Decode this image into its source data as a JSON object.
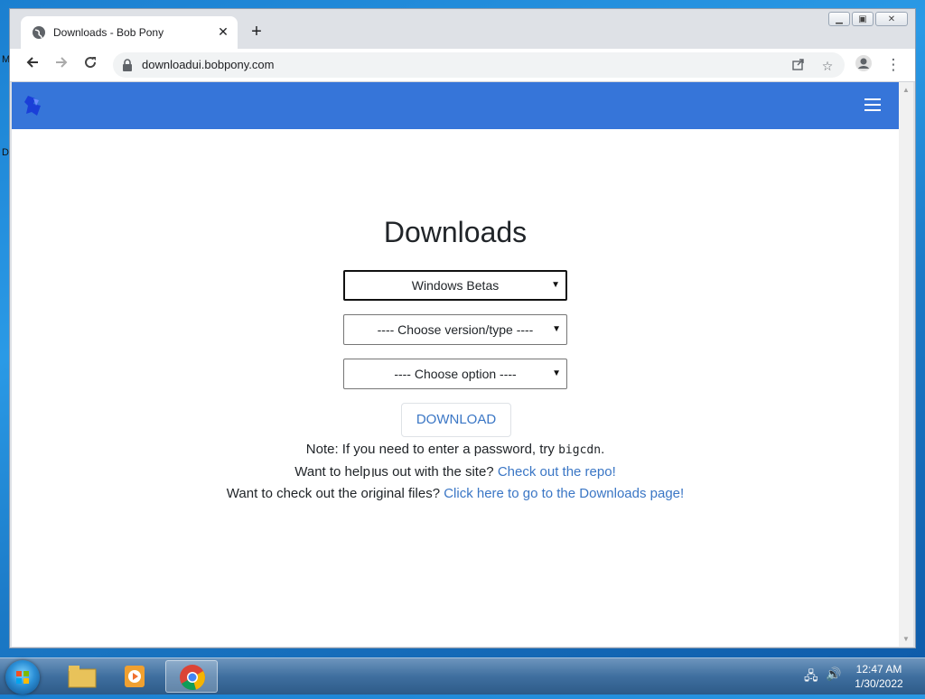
{
  "desktop": {
    "left_chars": [
      "M",
      "D"
    ]
  },
  "browser": {
    "tab_title": "Downloads - Bob Pony",
    "tab_close": "✕",
    "new_tab": "+",
    "url": "downloadui.bobpony.com",
    "window_controls": [
      "▁",
      "▣",
      "✕"
    ]
  },
  "page": {
    "heading": "Downloads",
    "select_product": "Windows Betas",
    "select_version": "---- Choose version/type ----",
    "select_option": "---- Choose option ----",
    "download_button": "DOWNLOAD",
    "note_prefix": "Note: If you need to enter a password, try ",
    "note_code": "bigcdn",
    "note_suffix": ".",
    "help_text": "Want to help us out with the site? ",
    "help_link": "Check out the repo!",
    "original_text": "Want to check out the original files? ",
    "original_link": "Click here to go to the Downloads page!"
  },
  "taskbar": {
    "time": "12:47 AM",
    "date": "1/30/2022"
  },
  "colors": {
    "navbar": "#3675d9",
    "link": "#3a76c5"
  }
}
